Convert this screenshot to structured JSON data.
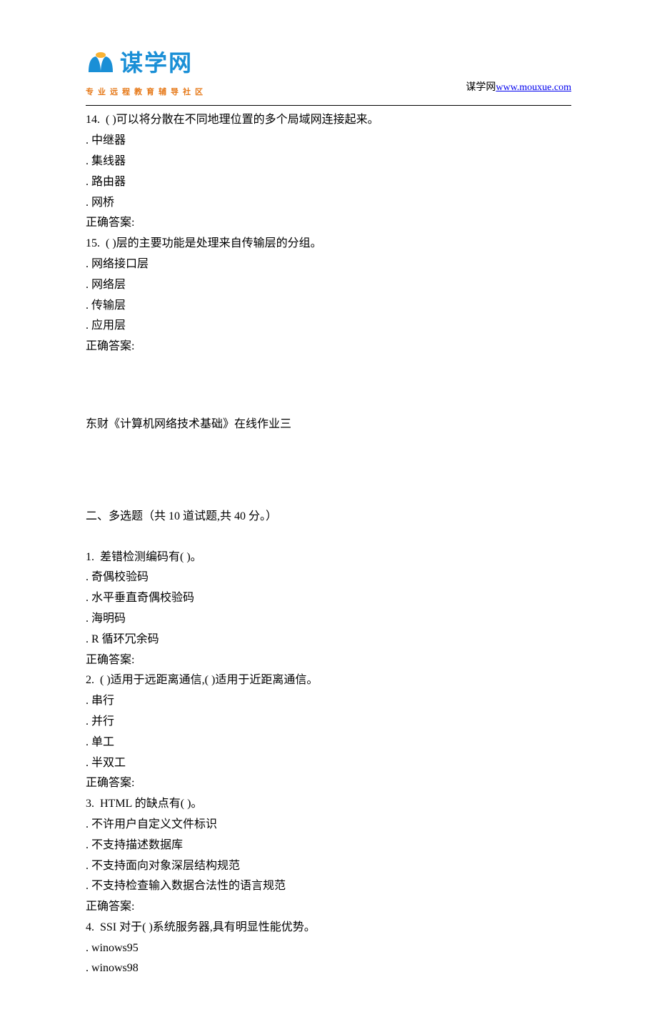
{
  "header": {
    "logo_main": "谋学网",
    "logo_sub": "专业远程教育辅导社区",
    "site_label": "谋学网",
    "site_url": "www.mouxue.com"
  },
  "content": {
    "q14": {
      "stem": "14.  ( )可以将分散在不同地理位置的多个局域网连接起来。",
      "opts": [
        ". 中继器",
        ". 集线器",
        ". 路由器",
        ". 网桥"
      ],
      "answer": "正确答案:"
    },
    "q15": {
      "stem": "15.  ( )层的主要功能是处理来自传输层的分组。",
      "opts": [
        ". 网络接口层",
        ". 网络层",
        ". 传输层",
        ". 应用层"
      ],
      "answer": "正确答案:"
    },
    "title2": "东财《计算机网络技术基础》在线作业三",
    "section2": "二、多选题（共 10 道试题,共 40 分。）",
    "mq1": {
      "stem": "1.  差错检测编码有( )。",
      "opts": [
        ". 奇偶校验码",
        ". 水平垂直奇偶校验码",
        ". 海明码",
        ". R 循环冗余码"
      ],
      "answer": "正确答案:"
    },
    "mq2": {
      "stem": "2.  ( )适用于远距离通信,( )适用于近距离通信。",
      "opts": [
        ". 串行",
        ". 并行",
        ". 单工",
        ". 半双工"
      ],
      "answer": "正确答案:"
    },
    "mq3": {
      "stem": "3.  HTML 的缺点有( )。",
      "opts": [
        ". 不许用户自定义文件标识",
        ". 不支持描述数据库",
        ". 不支持面向对象深层结构规范",
        ". 不支持检查输入数据合法性的语言规范"
      ],
      "answer": "正确答案:"
    },
    "mq4": {
      "stem": "4.  SSI 对于( )系统服务器,具有明显性能优势。",
      "opts": [
        ". winows95",
        ". winows98"
      ]
    }
  }
}
